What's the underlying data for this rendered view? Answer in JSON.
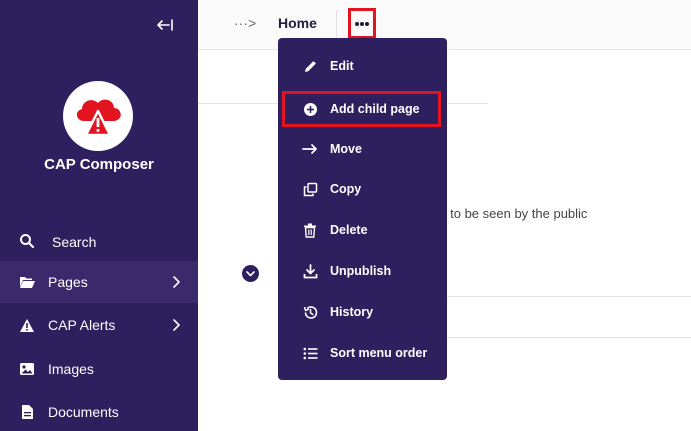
{
  "app": {
    "name": "CAP Composer"
  },
  "sidebar": {
    "search_label": "Search",
    "items": [
      {
        "label": "Pages",
        "icon": "folder-open-icon",
        "has_submenu": true,
        "active": true
      },
      {
        "label": "CAP Alerts",
        "icon": "warning-icon",
        "has_submenu": true,
        "active": false
      },
      {
        "label": "Images",
        "icon": "image-icon",
        "has_submenu": false,
        "active": false
      },
      {
        "label": "Documents",
        "icon": "document-icon",
        "has_submenu": false,
        "active": false
      }
    ]
  },
  "header": {
    "breadcrumb_ellipsis": "···>",
    "breadcrumb_current": "Home"
  },
  "content": {
    "visibility_text": "it to be seen by the public"
  },
  "dropdown": {
    "items": [
      {
        "label": "Edit",
        "icon": "pencil-icon"
      },
      {
        "label": "Add child page",
        "icon": "plus-circle-icon"
      },
      {
        "label": "Move",
        "icon": "arrow-right-icon"
      },
      {
        "label": "Copy",
        "icon": "copy-icon"
      },
      {
        "label": "Delete",
        "icon": "trash-icon"
      },
      {
        "label": "Unpublish",
        "icon": "download-icon"
      },
      {
        "label": "History",
        "icon": "history-icon"
      },
      {
        "label": "Sort menu order",
        "icon": "list-icon"
      }
    ]
  },
  "colors": {
    "sidebar_bg": "#2e1f5e",
    "highlight": "#e1141f",
    "logo_red": "#e1141f"
  }
}
